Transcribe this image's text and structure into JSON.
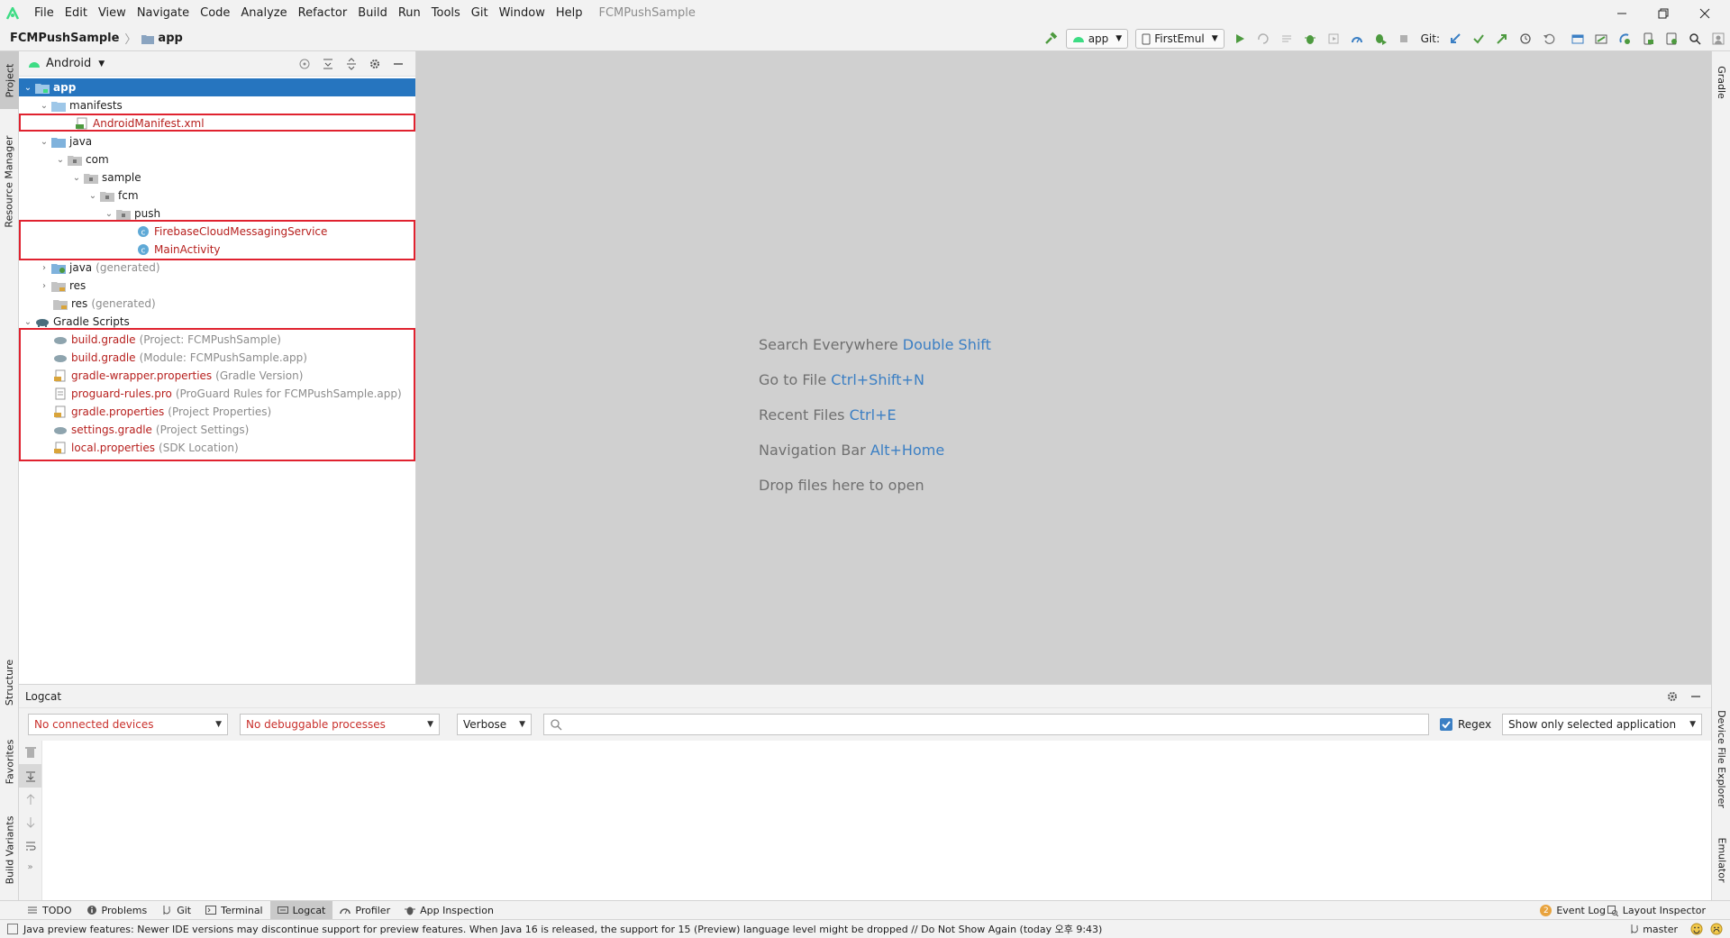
{
  "menu": [
    "File",
    "Edit",
    "View",
    "Navigate",
    "Code",
    "Analyze",
    "Refactor",
    "Build",
    "Run",
    "Tools",
    "Git",
    "Window",
    "Help"
  ],
  "window_title": "FCMPushSample",
  "breadcrumb": {
    "project": "FCMPushSample",
    "module": "app"
  },
  "toolbar": {
    "run_config": "app",
    "device": "FirstEmul",
    "git_label": "Git:"
  },
  "project_panel": {
    "view_mode": "Android"
  },
  "tree": {
    "app": "app",
    "manifests": "manifests",
    "android_manifest": "AndroidManifest.xml",
    "java": "java",
    "com": "com",
    "sample": "sample",
    "fcm": "fcm",
    "push": "push",
    "fcm_service": "FirebaseCloudMessagingService",
    "main_activity": "MainActivity",
    "java_generated": "java",
    "java_generated_hint": "(generated)",
    "res": "res",
    "res_generated": "res",
    "res_generated_hint": "(generated)",
    "gradle_scripts": "Gradle Scripts",
    "build_gradle_project": "build.gradle",
    "build_gradle_project_hint": "(Project: FCMPushSample)",
    "build_gradle_module": "build.gradle",
    "build_gradle_module_hint": "(Module: FCMPushSample.app)",
    "gradle_wrapper": "gradle-wrapper.properties",
    "gradle_wrapper_hint": "(Gradle Version)",
    "proguard": "proguard-rules.pro",
    "proguard_hint": "(ProGuard Rules for FCMPushSample.app)",
    "gradle_properties": "gradle.properties",
    "gradle_properties_hint": "(Project Properties)",
    "settings_gradle": "settings.gradle",
    "settings_gradle_hint": "(Project Settings)",
    "local_properties": "local.properties",
    "local_properties_hint": "(SDK Location)"
  },
  "editor_hints": [
    {
      "text": "Search Everywhere",
      "shortcut": "Double Shift"
    },
    {
      "text": "Go to File",
      "shortcut": "Ctrl+Shift+N"
    },
    {
      "text": "Recent Files",
      "shortcut": "Ctrl+E"
    },
    {
      "text": "Navigation Bar",
      "shortcut": "Alt+Home"
    },
    {
      "text": "Drop files here to open",
      "shortcut": ""
    }
  ],
  "left_tabs": {
    "project": "Project",
    "resource_manager": "Resource Manager",
    "structure": "Structure",
    "favorites": "Favorites",
    "build_variants": "Build Variants"
  },
  "right_tabs": {
    "gradle": "Gradle",
    "device_file_explorer": "Device File Explorer",
    "emulator": "Emulator"
  },
  "logcat": {
    "title": "Logcat",
    "devices": "No connected devices",
    "processes": "No debuggable processes",
    "level": "Verbose",
    "search_value": "",
    "regex_label": "Regex",
    "regex_checked": true,
    "filter": "Show only selected application"
  },
  "bottom_tabs": [
    "TODO",
    "Problems",
    "Git",
    "Terminal",
    "Logcat",
    "Profiler",
    "App Inspection"
  ],
  "bottom_right": {
    "event_log": "Event Log",
    "event_badge": "2",
    "layout_inspector": "Layout Inspector"
  },
  "status": {
    "message": "Java preview features: Newer IDE versions may discontinue support for preview features. When Java 16 is released, the support for 15 (Preview) language level might be dropped // Do Not Show Again (today 오후 9:43)",
    "branch": "master"
  },
  "colors": {
    "selection": "#2675bf",
    "highlight_box": "#e0222f",
    "modified_file": "#b7201e",
    "shortcut": "#3b7fc4",
    "android_green": "#3ddc84"
  }
}
